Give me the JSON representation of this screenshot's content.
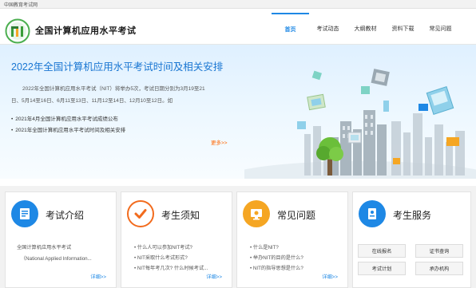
{
  "topbar": {
    "text": "中国教育考试网"
  },
  "header": {
    "site_name": "全国计算机应用水平考试"
  },
  "nav": {
    "items": [
      "首页",
      "考试动态",
      "大纲教材",
      "资料下载",
      "常见问题"
    ],
    "active_index": 0
  },
  "banner": {
    "title": "2022年全国计算机应用水平考试时间及相关安排",
    "description": "2022年全国计算机应用水平考试（NIT）将举办5次，考试日期分别为3月19至21日、5月14至16日、6月11至13日、11月12至14日、12月10至12日。如",
    "news": [
      "2021年4月全国计算机应用水平考试成绩公布",
      "2021年全国计算机应用水平考试时间及相关安排"
    ],
    "more": "更多>>"
  },
  "cards": {
    "intro": {
      "title": "考试介绍",
      "lines": [
        "全国计算机应用水平考试",
        "（National Applied Information..."
      ],
      "more": "详细>>"
    },
    "notice": {
      "title": "考生须知",
      "items": [
        "什么人可以参加NIT考试?",
        "NIT采取什么考试形式?",
        "NIT每年考几次? 什么时候考试..."
      ],
      "more": "详细>>"
    },
    "faq": {
      "title": "常见问题",
      "items": [
        "什么是NIT?",
        "举办NIT的目的是什么?",
        "NIT的指导思想是什么?"
      ],
      "more": "详细>>"
    },
    "service": {
      "title": "考生服务",
      "buttons": [
        "在线报名",
        "证书查询",
        "考试计划",
        "承办机构"
      ]
    }
  },
  "colors": {
    "brand_blue": "#1e88e5",
    "title_blue": "#1976d2",
    "more_orange": "#ff6600",
    "icon_orange": "#f26b1d"
  }
}
